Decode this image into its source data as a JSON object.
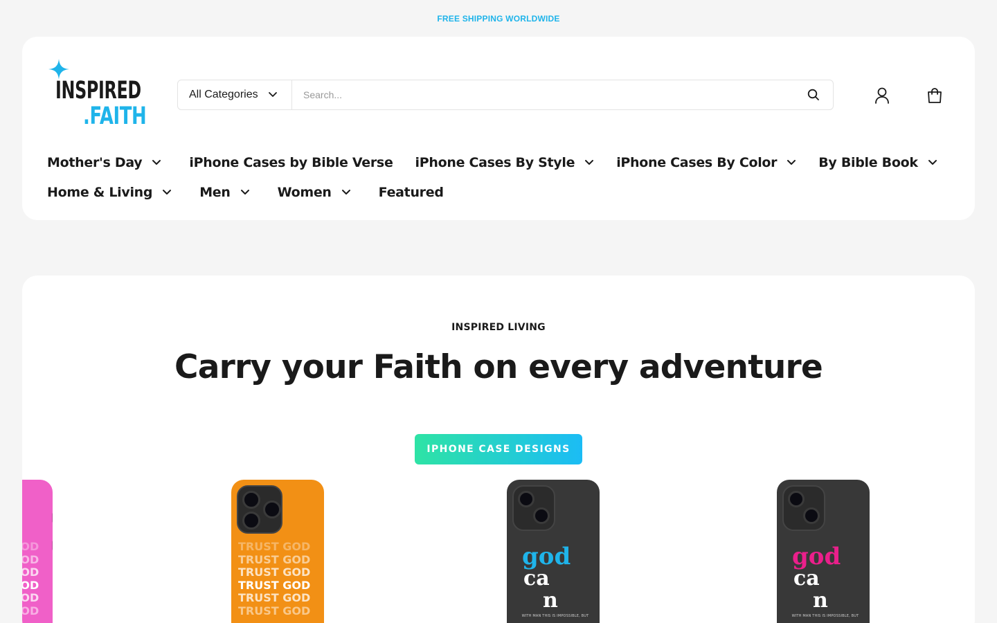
{
  "announcement": {
    "text": "FREE SHIPPING WORLDWIDE"
  },
  "header": {
    "logo": {
      "line1": "INSPIRED",
      "line2": ".FAITH"
    },
    "search": {
      "category": "All Categories",
      "placeholder": "Search..."
    },
    "icons": {
      "account": "user-icon",
      "cart": "shopping-bag-icon",
      "search": "search-icon"
    }
  },
  "nav": {
    "row1": [
      {
        "label": "Mother's Day",
        "dropdown": true
      },
      {
        "label": "iPhone Cases by Bible Verse",
        "dropdown": false
      },
      {
        "label": "iPhone Cases By Style",
        "dropdown": true
      },
      {
        "label": "iPhone Cases By Color",
        "dropdown": true
      },
      {
        "label": "By Bible Book",
        "dropdown": true
      }
    ],
    "row2": [
      {
        "label": "Home & Living",
        "dropdown": true
      },
      {
        "label": "Men",
        "dropdown": true
      },
      {
        "label": "Women",
        "dropdown": true
      },
      {
        "label": "Featured",
        "dropdown": false
      }
    ]
  },
  "hero": {
    "eyebrow": "INSPIRED LIVING",
    "title": "Carry your Faith on every adventure",
    "cta": "IPHONE CASE DESIGNS"
  },
  "products": [
    {
      "color": "#f060c8",
      "text": "TRUST GOD"
    },
    {
      "color": "#f29015",
      "text": "TRUST GOD"
    },
    {
      "color": "#383838",
      "accent": "#1fb4ea",
      "word1": "god",
      "word2": "ca",
      "word3": "n",
      "small": "WITH MAN THIS IS IMPOSSIBLE, BUT"
    },
    {
      "color": "#383838",
      "accent": "#ea1f8b",
      "word1": "god",
      "word2": "ca",
      "word3": "n",
      "small": "WITH MAN THIS IS IMPOSSIBLE, BUT"
    }
  ],
  "colors": {
    "accent": "#1fb4ea",
    "cta_from": "#2ee3a5",
    "cta_to": "#1bbcf5"
  }
}
